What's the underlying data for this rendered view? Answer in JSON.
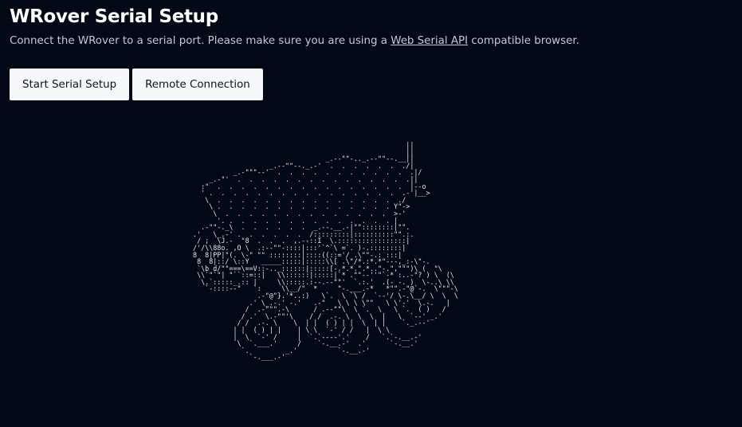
{
  "header": {
    "title": "WRover Serial Setup",
    "subtitle_before": "Connect the WRover to a serial port. Please make sure you are using a ",
    "subtitle_link": "Web Serial API",
    "subtitle_after": " compatible browser."
  },
  "actions": {
    "start_serial_setup_label": "Start Serial Setup",
    "remote_connection_label": "Remote Connection"
  },
  "illustration": {
    "icon": "rover-ascii-art"
  },
  "colors": {
    "background": "#030816",
    "button_background": "#f7f8fa",
    "button_text": "#0b1220",
    "text": "#ffffff",
    "muted_text": "#c2c8d6"
  }
}
